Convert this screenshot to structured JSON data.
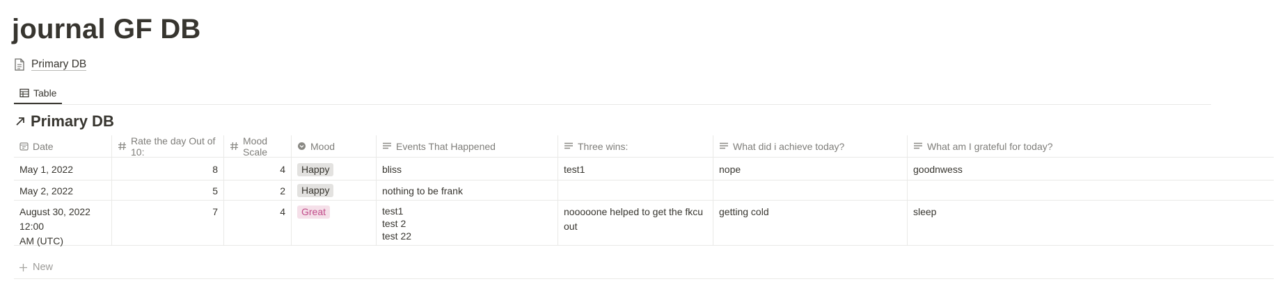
{
  "page": {
    "title": "journal GF DB",
    "linked_page_label": "Primary DB"
  },
  "tabs": [
    {
      "label": "Table",
      "icon": "table-icon",
      "active": true
    }
  ],
  "database": {
    "title": "Primary DB",
    "title_icon": "arrow-up-right-icon",
    "columns": [
      {
        "label": "Date",
        "icon": "calendar-icon"
      },
      {
        "label": "Rate the day Out of 10:",
        "icon": "hash-icon"
      },
      {
        "label": "Mood Scale",
        "icon": "hash-icon"
      },
      {
        "label": "Mood",
        "icon": "select-icon"
      },
      {
        "label": "Events That Happened",
        "icon": "text-icon"
      },
      {
        "label": "Three wins:",
        "icon": "text-icon"
      },
      {
        "label": "What did i achieve today?",
        "icon": "text-icon"
      },
      {
        "label": "What am I grateful for today?",
        "icon": "text-icon"
      }
    ],
    "rows": [
      {
        "date": "May 1, 2022",
        "rate": "8",
        "mood_scale": "4",
        "mood": "Happy",
        "events": "bliss",
        "wins": "test1",
        "achieve": "nope",
        "grateful": "goodnwess"
      },
      {
        "date": "May 2, 2022",
        "rate": "5",
        "mood_scale": "2",
        "mood": "Happy",
        "events": "nothing to be frank",
        "wins": "",
        "achieve": "",
        "grateful": ""
      },
      {
        "date": "August 30, 2022 12:00\nAM (UTC)",
        "rate": "7",
        "mood_scale": "4",
        "mood": "Great",
        "events": "test1\ntest 2\ntest 22",
        "wins": "nooooone helped to get the fkcu out",
        "achieve": "getting cold",
        "grateful": "sleep"
      }
    ],
    "new_label": "New"
  },
  "colors": {
    "text": "#37352f",
    "tag_happy_bg": "#e3e2e0",
    "tag_great_bg": "#f5e0e9",
    "tag_great_text": "#c14c8a"
  }
}
